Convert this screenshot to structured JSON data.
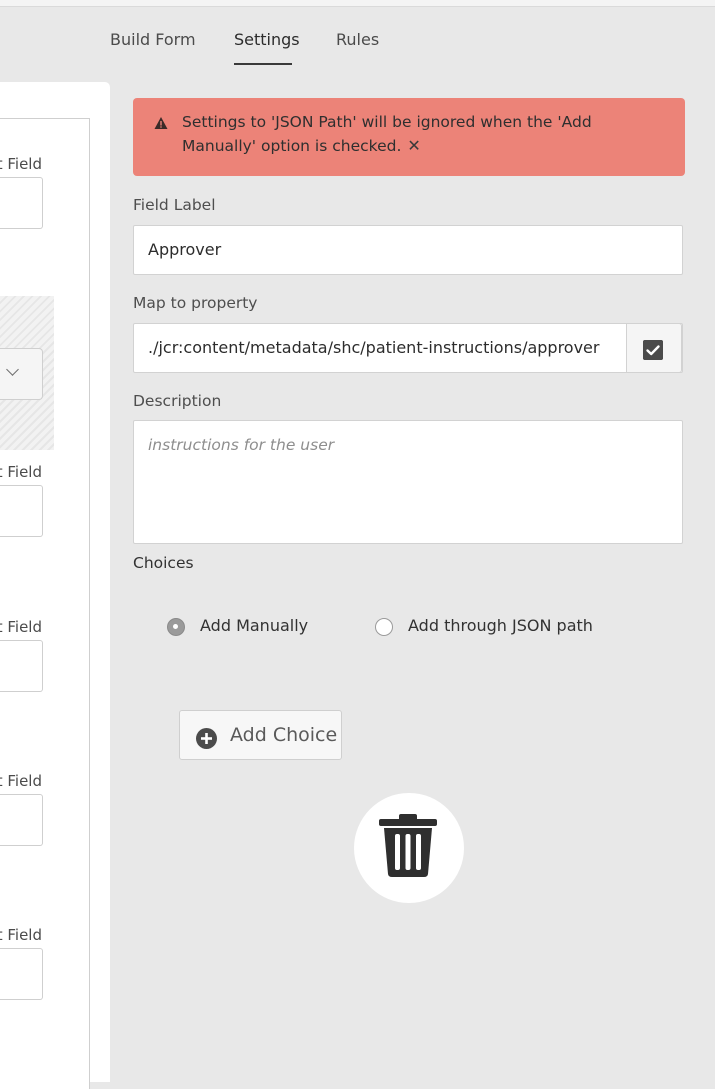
{
  "tabs": [
    {
      "label": "Build Form"
    },
    {
      "label": "Settings",
      "active": true
    },
    {
      "label": "Rules"
    }
  ],
  "left_panel": {
    "field_labels": [
      "t Field",
      "t Field",
      "t Field",
      "t Field",
      "t Field"
    ]
  },
  "alert": {
    "message": "Settings to 'JSON Path' will be ignored when the 'Add Manually' option is checked.",
    "close_glyph": "✕",
    "icon": "warning-icon",
    "color": "#ec8378"
  },
  "field_label": {
    "label": "Field Label",
    "value": "Approver"
  },
  "map_to_property": {
    "label": "Map to property",
    "value": "./jcr:content/metadata/shc/patient-instructions/approver",
    "checkbox_checked": true
  },
  "description": {
    "label": "Description",
    "placeholder": "instructions for the user"
  },
  "choices": {
    "label": "Choices",
    "options": [
      {
        "label": "Add Manually",
        "checked": true
      },
      {
        "label": "Add through JSON path",
        "checked": false
      }
    ],
    "add_button_label": "Add Choice"
  },
  "delete": {
    "icon": "trash-icon"
  }
}
